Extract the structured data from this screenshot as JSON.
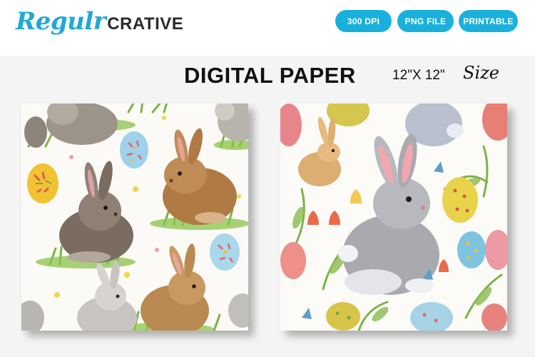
{
  "logo": {
    "script_text": "Regulr",
    "caps_text": "CRATIVE"
  },
  "badges": [
    "300 DPI",
    "PNG FILE",
    "PRINTABLE"
  ],
  "title": "DIGITAL PAPER",
  "size": {
    "dimensions": "12\"X 12\"",
    "word": "Size"
  },
  "colors": {
    "accent": "#19b0dd",
    "logo_blue": "#1fa9d6",
    "text_dark": "#111111"
  },
  "panels": [
    {
      "name": "left-pattern",
      "theme": "easter bunnies with painted eggs and grass"
    },
    {
      "name": "right-pattern",
      "theme": "grey bunny with eggs, tulips and leaves"
    }
  ]
}
